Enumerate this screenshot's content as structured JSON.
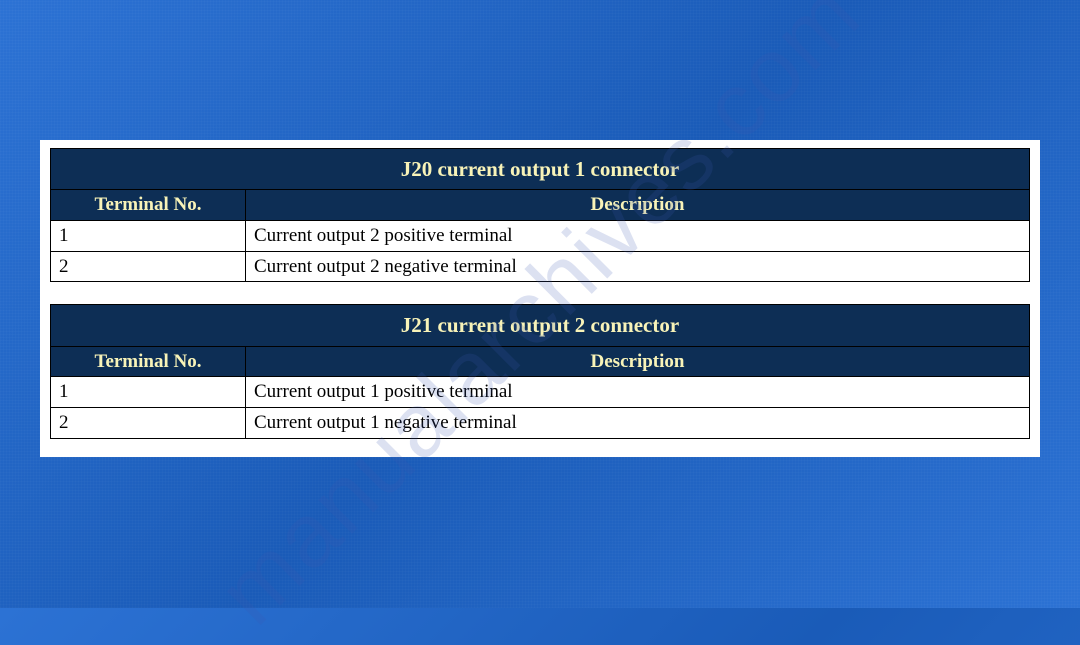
{
  "watermark": "manualarchives.com",
  "tables": [
    {
      "title": "J20 current output 1 connector",
      "headers": {
        "terminal": "Terminal No.",
        "description": "Description"
      },
      "rows": [
        {
          "terminal": "1",
          "description": "Current output 2 positive terminal"
        },
        {
          "terminal": "2",
          "description": "Current output 2 negative terminal"
        }
      ]
    },
    {
      "title": "J21 current output 2 connector",
      "headers": {
        "terminal": "Terminal No.",
        "description": "Description"
      },
      "rows": [
        {
          "terminal": "1",
          "description": "Current output 1 positive terminal"
        },
        {
          "terminal": "2",
          "description": "Current output 1 negative terminal"
        }
      ]
    }
  ]
}
